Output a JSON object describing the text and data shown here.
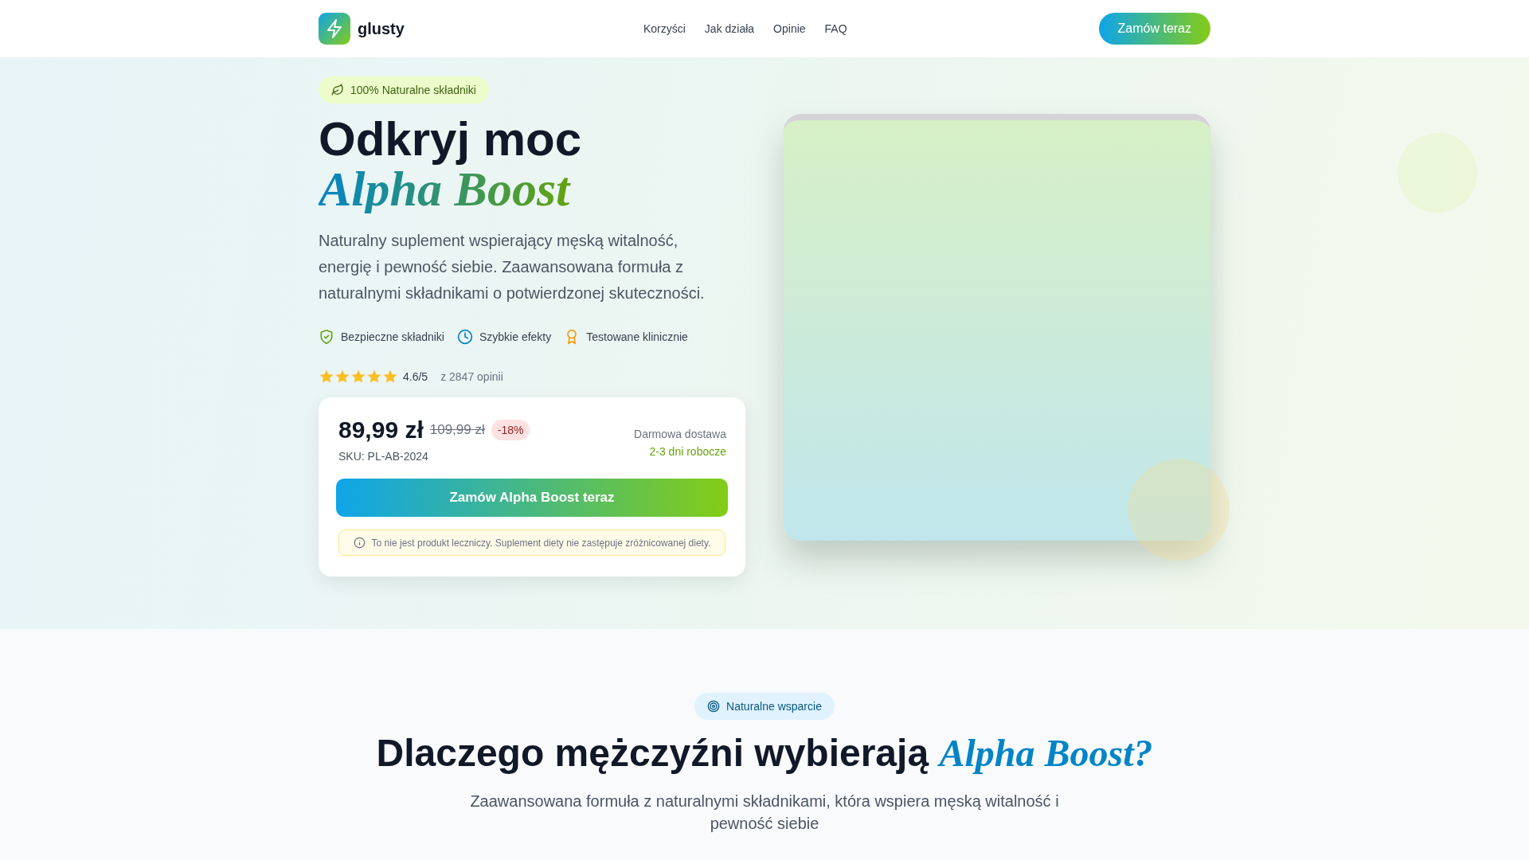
{
  "header": {
    "brand": "glusty",
    "nav": [
      {
        "label": "Korzyści"
      },
      {
        "label": "Jak działa"
      },
      {
        "label": "Opinie"
      },
      {
        "label": "FAQ"
      }
    ],
    "cta": "Zamów teraz"
  },
  "hero": {
    "badge": "100% Naturalne składniki",
    "title": "Odkryj moc",
    "title_accent": "Alpha Boost",
    "description": "Naturalny suplement wspierający męską witalność, energię i pewność siebie. Zaawansowana formuła z naturalnymi składnikami o potwierdzonej skuteczności.",
    "features": [
      {
        "kind": "shield",
        "label": "Bezpieczne składniki"
      },
      {
        "kind": "clock",
        "label": "Szybkie efekty"
      },
      {
        "kind": "award",
        "label": "Testowane klinicznie"
      }
    ],
    "rating": {
      "stars": 5,
      "score": "4.6/5",
      "count": "z 2847 opinii"
    },
    "price_card": {
      "price": "89,99 zł",
      "old_price": "109,99 zł",
      "discount": "-18%",
      "sku": "SKU: PL-AB-2024",
      "shipping": "Darmowa dostawa",
      "delivery": "2-3 dni robocze",
      "button": "Zamów Alpha Boost teraz",
      "notice": "To nie jest produkt leczniczy. Suplement diety nie zastępuje zróżnicowanej diety."
    }
  },
  "benefits": {
    "badge": "Naturalne wsparcie",
    "title": "Dlaczego mężczyźni wybierają",
    "title_accent": "Alpha Boost?",
    "subtitle": "Zaawansowana formuła z naturalnymi składnikami, która wspiera męską witalność i pewność siebie"
  }
}
